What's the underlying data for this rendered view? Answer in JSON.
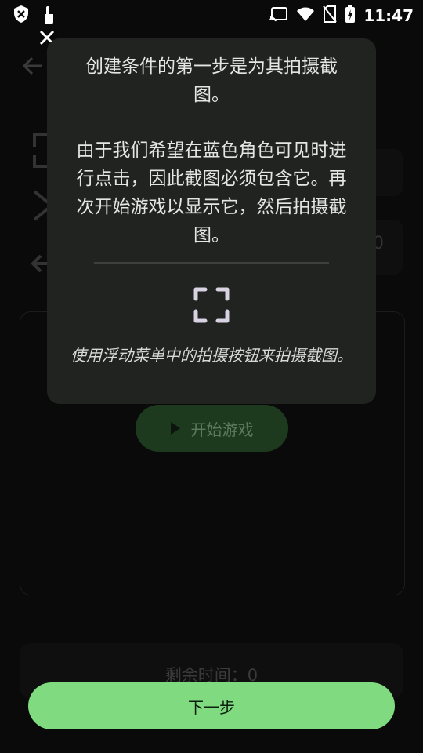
{
  "status_bar": {
    "time": "11:47",
    "icons_left": [
      "shield-icon",
      "touch-icon"
    ],
    "icons_right": [
      "cast-icon",
      "wifi-icon",
      "no-sim-icon",
      "battery-icon"
    ]
  },
  "tutorial": {
    "title": "创建条件的第一步是为其拍摄截图。",
    "body": "由于我们希望在蓝色角色可见时进行点击，因此截图必须包含它。再次开始游戏以显示它，然后拍摄截图。",
    "hint": "使用浮动菜单中的拍摄按钮来拍摄截图。"
  },
  "background": {
    "play_label": "开始游戏",
    "value_zero": "0",
    "timer_text": "剩余时间：0"
  },
  "next_button": {
    "label": "下一步"
  },
  "colors": {
    "accent": "#7fda80",
    "popup_bg": "#202320",
    "play_btn_bg": "#1d3a1f"
  }
}
